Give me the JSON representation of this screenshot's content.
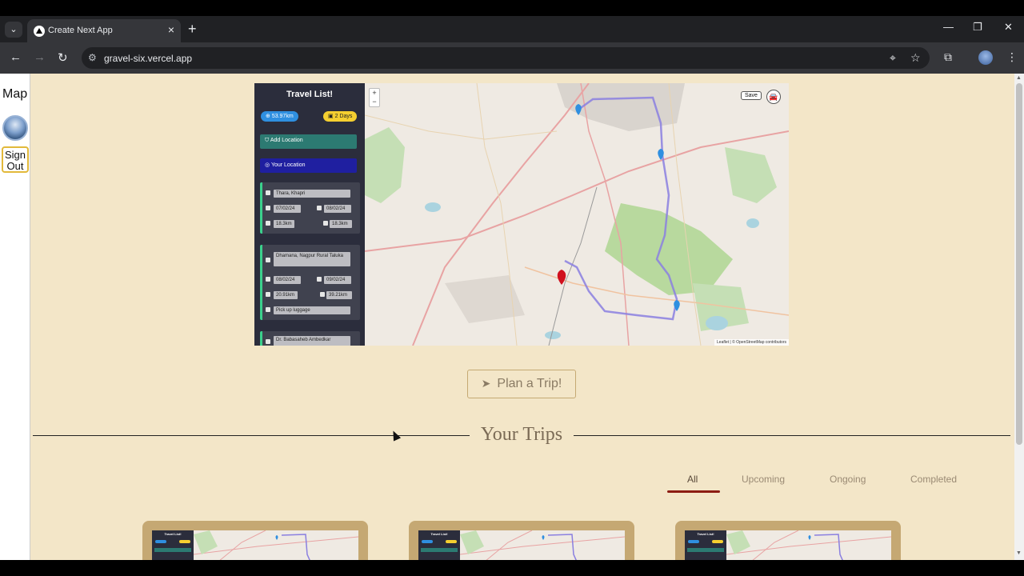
{
  "browser": {
    "tab_title": "Create Next App",
    "url": "gravel-six.vercel.app"
  },
  "left_panel": {
    "map_label": "Map",
    "sign_out_line1": "Sign",
    "sign_out_line2": "Out"
  },
  "travel_list": {
    "title": "Travel List!",
    "distance_badge": "53.97km",
    "days_badge": "2 Days",
    "add_location_label": "Add Location",
    "your_location_label": "Your Location",
    "locations": [
      {
        "name": "Thara, Khapri",
        "start_date": "07/02/24",
        "end_date": "08/02/24",
        "distance": "18.3km",
        "home_distance": "18.3km"
      },
      {
        "name": "Dhamana, Nagpur Rural Taluka",
        "start_date": "08/02/24",
        "end_date": "09/02/24",
        "distance": "20.91km",
        "home_distance": "39.21km",
        "note": "Pick up luggage"
      },
      {
        "name": "Dr. Babasaheb Ambedkar"
      }
    ]
  },
  "map": {
    "save_label": "Save",
    "zoom_in": "+",
    "zoom_out": "−",
    "attribution": "Leaflet | © OpenStreetMap contributors",
    "route_color": "#8a7fe0",
    "marker_color": "#2f8fe0",
    "home_marker_color": "#d0101e"
  },
  "main": {
    "plan_button_label": "Plan a Trip!",
    "trips_title": "Your Trips",
    "filters": [
      "All",
      "Upcoming",
      "Ongoing",
      "Completed"
    ],
    "active_filter": "All",
    "trip_cards": [
      {
        "thumb_title": "Travel List!"
      },
      {
        "thumb_title": "Travel List!"
      },
      {
        "thumb_title": "Travel List!"
      }
    ]
  },
  "colors": {
    "page_background": "#f3e6c8",
    "sidebar_background": "#2b2d3c",
    "accent_underline": "#8c1c13",
    "card_gold": "#c5a873"
  }
}
